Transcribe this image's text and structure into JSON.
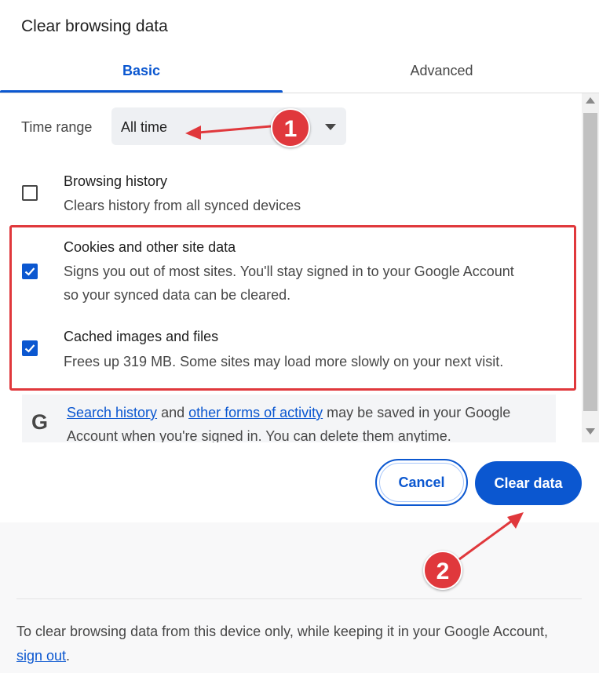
{
  "dialog": {
    "title": "Clear browsing data"
  },
  "tabs": [
    {
      "label": "Basic",
      "selected": true
    },
    {
      "label": "Advanced",
      "selected": false
    }
  ],
  "time_range": {
    "label": "Time range",
    "value": "All time"
  },
  "items": [
    {
      "title": "Browsing history",
      "description": [
        "Clears history from all synced devices"
      ],
      "checked": false
    },
    {
      "title": "Cookies and other site data",
      "description": [
        "Signs you out of most sites. You'll stay signed in to your Google Account",
        "so your synced data can be cleared."
      ],
      "checked": true
    },
    {
      "title": "Cached images and files",
      "description": [
        "Frees up 319 MB. Some sites may load more slowly on your next visit."
      ],
      "checked": true
    }
  ],
  "google_notice": {
    "icon": "G",
    "link1": "Search history",
    "text1": " and ",
    "link2": "other forms of activity",
    "text2": " may be saved in your Google Account when you're signed in. You can delete them anytime."
  },
  "buttons": {
    "cancel": "Cancel",
    "clear": "Clear data"
  },
  "footer": {
    "text": "To clear browsing data from this device only, while keeping it in your Google Account, ",
    "link": "sign out",
    "suffix": "."
  },
  "annotations": [
    {
      "number": "1"
    },
    {
      "number": "2"
    }
  ],
  "colors": {
    "accent": "#0b57d0",
    "annotation": "#e0383c"
  }
}
